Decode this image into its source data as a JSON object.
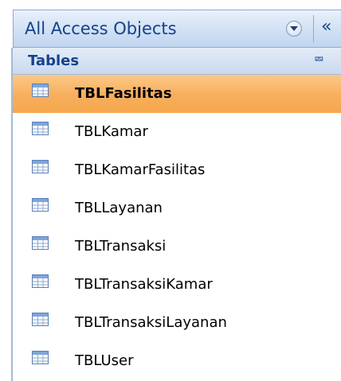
{
  "nav_pane": {
    "title": "All Access Objects",
    "group": {
      "title": "Tables",
      "items": [
        {
          "label": "TBLFasilitas",
          "selected": true
        },
        {
          "label": "TBLKamar",
          "selected": false
        },
        {
          "label": "TBLKamarFasilitas",
          "selected": false
        },
        {
          "label": "TBLLayanan",
          "selected": false
        },
        {
          "label": "TBLTransaksi",
          "selected": false
        },
        {
          "label": "TBLTransaksiKamar",
          "selected": false
        },
        {
          "label": "TBLTransaksiLayanan",
          "selected": false
        },
        {
          "label": "TBLUser",
          "selected": false
        }
      ]
    },
    "icons": {
      "menu_dropdown": "chevron-down-circle-icon",
      "shutter_bar": "double-chevron-left-icon",
      "group_collapse": "double-chevron-up-icon",
      "table": "table-icon"
    }
  },
  "colors": {
    "header_text": "#15428b",
    "selection": "#f7ae5d",
    "header_bg": "#cfdff3"
  }
}
